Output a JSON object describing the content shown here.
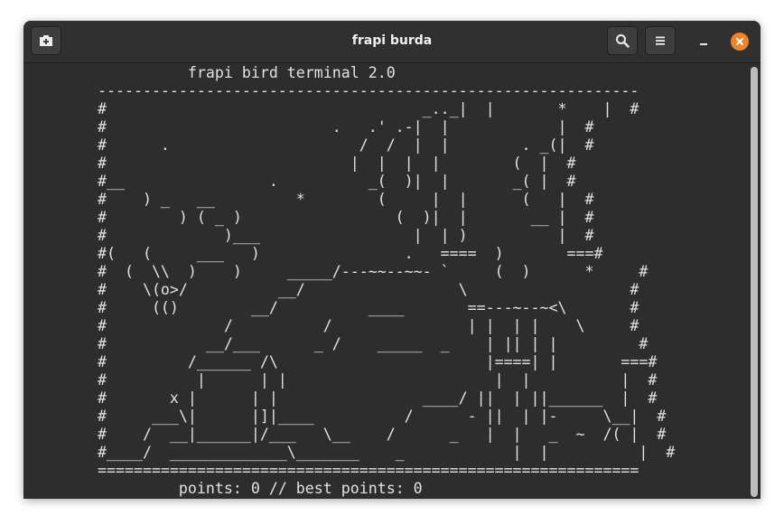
{
  "window": {
    "title": "frapi burda",
    "new_tab_icon": "new-tab-icon",
    "search_icon": "search-icon",
    "menu_icon": "hamburger-menu-icon",
    "minimize_icon": "minimize-icon",
    "close_icon": "close-icon",
    "close_color": "#f08228"
  },
  "terminal": {
    "lines": [
      "          frapi bird terminal 2.0",
      "------------------------------------------------------------",
      "#                                   _.._|  |       *    |  #",
      "#                         .   .' .-|  |            |  #",
      "#      .                     /  /  |  |        . _(|  #",
      "#                           |  |  |  |        (  |  #",
      "#__                .          _(  )|  |       _( |  #",
      "#    ) _   __         *        (     |  |      (   |  #",
      "#        ) ( _ )                 (  )|  |       __ |  #",
      "#             )___                 |  | )          |  #",
      "#(   (     ___   )                .   ====  )       ===#",
      "#  (  \\\\  )    )     _____/---~~--~~- `     (  )      *     #",
      "#    \\(o>/          __/                 \\                  #",
      "#     (()        __/          ____       ==---~--~<\\       #",
      "#             /          /               | |  | |    \\     #",
      "#           __/___      _ /    _____  _    | || | |         #",
      "#         /______ /\\                       |====| |       ===#",
      "#          |      | |                       |  |          |  #",
      "#       x |      | |                ____/ ||  | ||______  |  #",
      "#     ___\\|      |]|____          /      - ||  | |-     \\__|  #",
      "#    /  __|______|/___   \\__    /      _   |  |   _  ~  /( |  #",
      "#____/  _____________\\_______    _            |  |          |  #",
      "============================================================"
    ],
    "footer": "points: 0 // best points: 0"
  }
}
